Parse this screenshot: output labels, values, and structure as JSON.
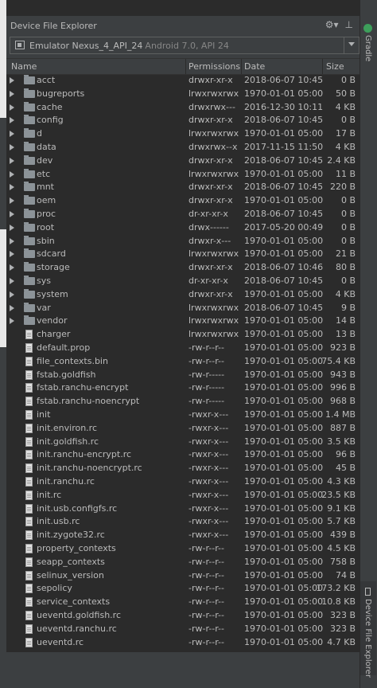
{
  "panel": {
    "title": "Device File Explorer",
    "gear_glyph": "⚙▾",
    "minimize_glyph": "⊥"
  },
  "device": {
    "name": "Emulator Nexus_4_API_24",
    "description": "Android 7.0, API 24"
  },
  "columns": [
    "Name",
    "Permissions",
    "Date",
    "Size"
  ],
  "side_tabs": {
    "gradle": "Gradle",
    "device_file_explorer": "Device File Explorer"
  },
  "colors": {
    "background": "#2b2b2b",
    "panel": "#3c3f41",
    "text": "#bbbbbb",
    "folder_icon": "#8c9398",
    "gradle_icon": "#3d9f5b"
  },
  "files": [
    {
      "name": "acct",
      "perm": "drwxr-xr-x",
      "date": "2018-06-07 10:45",
      "size": "0 B",
      "type": "folder"
    },
    {
      "name": "bugreports",
      "perm": "lrwxrwxrwx",
      "date": "1970-01-01 05:00",
      "size": "50 B",
      "type": "folder"
    },
    {
      "name": "cache",
      "perm": "drwxrwx---",
      "date": "2016-12-30 10:11",
      "size": "4 KB",
      "type": "folder"
    },
    {
      "name": "config",
      "perm": "drwxr-xr-x",
      "date": "2018-06-07 10:45",
      "size": "0 B",
      "type": "folder"
    },
    {
      "name": "d",
      "perm": "lrwxrwxrwx",
      "date": "1970-01-01 05:00",
      "size": "17 B",
      "type": "folder"
    },
    {
      "name": "data",
      "perm": "drwxrwx--x",
      "date": "2017-11-15 11:50",
      "size": "4 KB",
      "type": "folder"
    },
    {
      "name": "dev",
      "perm": "drwxr-xr-x",
      "date": "2018-06-07 10:45",
      "size": "2.4 KB",
      "type": "folder"
    },
    {
      "name": "etc",
      "perm": "lrwxrwxrwx",
      "date": "1970-01-01 05:00",
      "size": "11 B",
      "type": "folder"
    },
    {
      "name": "mnt",
      "perm": "drwxr-xr-x",
      "date": "2018-06-07 10:45",
      "size": "220 B",
      "type": "folder"
    },
    {
      "name": "oem",
      "perm": "drwxr-xr-x",
      "date": "1970-01-01 05:00",
      "size": "0 B",
      "type": "folder"
    },
    {
      "name": "proc",
      "perm": "dr-xr-xr-x",
      "date": "2018-06-07 10:45",
      "size": "0 B",
      "type": "folder"
    },
    {
      "name": "root",
      "perm": "drwx------",
      "date": "2017-05-20 00:49",
      "size": "0 B",
      "type": "folder"
    },
    {
      "name": "sbin",
      "perm": "drwxr-x---",
      "date": "1970-01-01 05:00",
      "size": "0 B",
      "type": "folder"
    },
    {
      "name": "sdcard",
      "perm": "lrwxrwxrwx",
      "date": "1970-01-01 05:00",
      "size": "21 B",
      "type": "folder"
    },
    {
      "name": "storage",
      "perm": "drwxr-xr-x",
      "date": "2018-06-07 10:46",
      "size": "80 B",
      "type": "folder"
    },
    {
      "name": "sys",
      "perm": "dr-xr-xr-x",
      "date": "2018-06-07 10:45",
      "size": "0 B",
      "type": "folder"
    },
    {
      "name": "system",
      "perm": "drwxr-xr-x",
      "date": "1970-01-01 05:00",
      "size": "4 KB",
      "type": "folder"
    },
    {
      "name": "var",
      "perm": "lrwxrwxrwx",
      "date": "2018-06-07 10:45",
      "size": "9 B",
      "type": "folder"
    },
    {
      "name": "vendor",
      "perm": "lrwxrwxrwx",
      "date": "1970-01-01 05:00",
      "size": "14 B",
      "type": "folder"
    },
    {
      "name": "charger",
      "perm": "lrwxrwxrwx",
      "date": "1970-01-01 05:00",
      "size": "13 B",
      "type": "file"
    },
    {
      "name": "default.prop",
      "perm": "-rw-r--r--",
      "date": "1970-01-01 05:00",
      "size": "923 B",
      "type": "file"
    },
    {
      "name": "file_contexts.bin",
      "perm": "-rw-r--r--",
      "date": "1970-01-01 05:00",
      "size": "75.4 KB",
      "type": "file"
    },
    {
      "name": "fstab.goldfish",
      "perm": "-rw-r-----",
      "date": "1970-01-01 05:00",
      "size": "943 B",
      "type": "file"
    },
    {
      "name": "fstab.ranchu-encrypt",
      "perm": "-rw-r-----",
      "date": "1970-01-01 05:00",
      "size": "996 B",
      "type": "file"
    },
    {
      "name": "fstab.ranchu-noencrypt",
      "perm": "-rw-r-----",
      "date": "1970-01-01 05:00",
      "size": "968 B",
      "type": "file"
    },
    {
      "name": "init",
      "perm": "-rwxr-x---",
      "date": "1970-01-01 05:00",
      "size": "1.4 MB",
      "type": "file"
    },
    {
      "name": "init.environ.rc",
      "perm": "-rwxr-x---",
      "date": "1970-01-01 05:00",
      "size": "887 B",
      "type": "file"
    },
    {
      "name": "init.goldfish.rc",
      "perm": "-rwxr-x---",
      "date": "1970-01-01 05:00",
      "size": "3.5 KB",
      "type": "file"
    },
    {
      "name": "init.ranchu-encrypt.rc",
      "perm": "-rwxr-x---",
      "date": "1970-01-01 05:00",
      "size": "96 B",
      "type": "file"
    },
    {
      "name": "init.ranchu-noencrypt.rc",
      "perm": "-rwxr-x---",
      "date": "1970-01-01 05:00",
      "size": "45 B",
      "type": "file"
    },
    {
      "name": "init.ranchu.rc",
      "perm": "-rwxr-x---",
      "date": "1970-01-01 05:00",
      "size": "4.3 KB",
      "type": "file"
    },
    {
      "name": "init.rc",
      "perm": "-rwxr-x---",
      "date": "1970-01-01 05:00",
      "size": "23.5 KB",
      "type": "file"
    },
    {
      "name": "init.usb.configfs.rc",
      "perm": "-rwxr-x---",
      "date": "1970-01-01 05:00",
      "size": "9.1 KB",
      "type": "file"
    },
    {
      "name": "init.usb.rc",
      "perm": "-rwxr-x---",
      "date": "1970-01-01 05:00",
      "size": "5.7 KB",
      "type": "file"
    },
    {
      "name": "init.zygote32.rc",
      "perm": "-rwxr-x---",
      "date": "1970-01-01 05:00",
      "size": "439 B",
      "type": "file"
    },
    {
      "name": "property_contexts",
      "perm": "-rw-r--r--",
      "date": "1970-01-01 05:00",
      "size": "4.5 KB",
      "type": "file"
    },
    {
      "name": "seapp_contexts",
      "perm": "-rw-r--r--",
      "date": "1970-01-01 05:00",
      "size": "758 B",
      "type": "file"
    },
    {
      "name": "selinux_version",
      "perm": "-rw-r--r--",
      "date": "1970-01-01 05:00",
      "size": "74 B",
      "type": "file"
    },
    {
      "name": "sepolicy",
      "perm": "-rw-r--r--",
      "date": "1970-01-01 05:00",
      "size": "173.2 KB",
      "type": "file"
    },
    {
      "name": "service_contexts",
      "perm": "-rw-r--r--",
      "date": "1970-01-01 05:00",
      "size": "10.8 KB",
      "type": "file"
    },
    {
      "name": "ueventd.goldfish.rc",
      "perm": "-rw-r--r--",
      "date": "1970-01-01 05:00",
      "size": "323 B",
      "type": "file"
    },
    {
      "name": "ueventd.ranchu.rc",
      "perm": "-rw-r--r--",
      "date": "1970-01-01 05:00",
      "size": "323 B",
      "type": "file"
    },
    {
      "name": "ueventd.rc",
      "perm": "-rw-r--r--",
      "date": "1970-01-01 05:00",
      "size": "4.7 KB",
      "type": "file"
    }
  ]
}
